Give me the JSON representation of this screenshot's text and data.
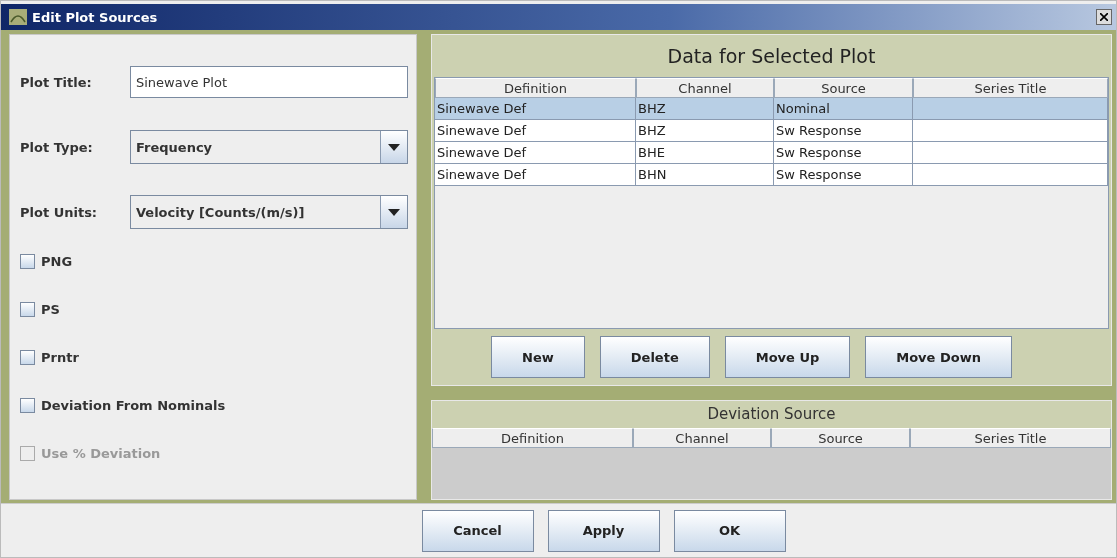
{
  "window": {
    "title": "Edit Plot Sources"
  },
  "form": {
    "fields": [
      {
        "kind": "text",
        "label": "Plot Title:",
        "value": "Sinewave Plot"
      },
      {
        "kind": "dropdown",
        "label": "Plot Type:",
        "value": "Frequency"
      },
      {
        "kind": "dropdown",
        "label": "Plot Units:",
        "value": "Velocity [Counts/(m/s)]"
      }
    ],
    "checkboxes": [
      {
        "label": "PNG",
        "checked": false,
        "disabled": false
      },
      {
        "label": "PS",
        "checked": false,
        "disabled": false
      },
      {
        "label": "Prntr",
        "checked": false,
        "disabled": false
      },
      {
        "label": "Deviation From Nominals",
        "checked": false,
        "disabled": false
      },
      {
        "label": "Use % Deviation",
        "checked": false,
        "disabled": true
      }
    ]
  },
  "data_panel": {
    "title": "Data for Selected Plot",
    "columns": [
      "Definition",
      "Channel",
      "Source",
      "Series Title"
    ],
    "rows": [
      {
        "cells": [
          "Sinewave Def",
          "BHZ",
          "Nominal",
          ""
        ],
        "selected": true
      },
      {
        "cells": [
          "Sinewave Def",
          "BHZ",
          "Sw Response",
          ""
        ],
        "selected": false
      },
      {
        "cells": [
          "Sinewave Def",
          "BHE",
          "Sw Response",
          ""
        ],
        "selected": false
      },
      {
        "cells": [
          "Sinewave Def",
          "BHN",
          "Sw Response",
          ""
        ],
        "selected": false
      }
    ],
    "buttons": [
      "New",
      "Delete",
      "Move Up",
      "Move Down"
    ]
  },
  "deviation_panel": {
    "title": "Deviation Source",
    "columns": [
      "Definition",
      "Channel",
      "Source",
      "Series Title"
    ]
  },
  "footer_buttons": [
    "Cancel",
    "Apply",
    "OK"
  ]
}
